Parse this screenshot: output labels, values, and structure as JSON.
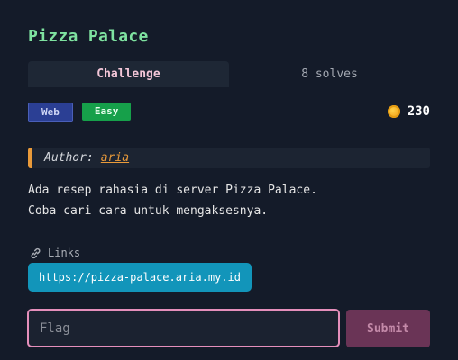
{
  "challenge": {
    "title": "Pizza Palace",
    "points": "230",
    "category": "Web",
    "difficulty": "Easy",
    "author_label": "Author:",
    "author_name": "aria",
    "description_line1": "Ada resep rahasia di server Pizza Palace.",
    "description_line2": "Coba cari cara untuk mengaksesnya.",
    "links_label": "Links",
    "link_url": "https://pizza-palace.aria.my.id"
  },
  "tabs": [
    {
      "label": "Challenge",
      "active": true
    },
    {
      "label": "8 solves",
      "active": false
    }
  ],
  "form": {
    "flag_placeholder": "Flag",
    "flag_value": "",
    "submit_label": "Submit"
  },
  "colors": {
    "background": "#141b29",
    "title": "#7ee2a0",
    "accent_author": "#e99a3a",
    "link_button": "#1295ba",
    "input_border": "#e58fbb",
    "submit_bg": "#6a3456",
    "badge_web": "#2b3f94",
    "badge_easy": "#16a04a"
  },
  "icons": {
    "points": "coin-icon",
    "links": "link-icon"
  }
}
